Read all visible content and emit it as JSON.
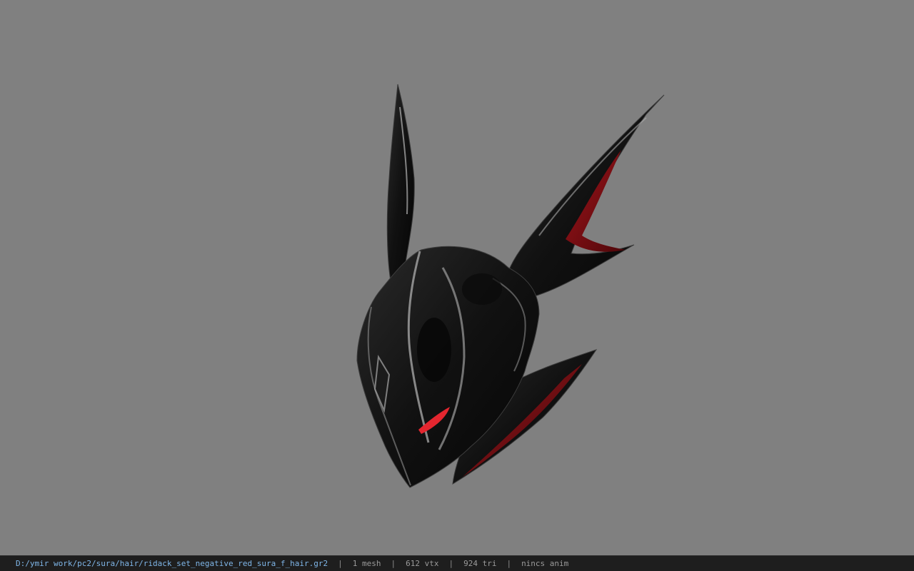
{
  "viewer": {
    "background": "#808080",
    "model": "helmet-model",
    "colors": {
      "shell": "#141414",
      "highlight": "#9a9a9a",
      "inner": "#7a0d12",
      "eye": "#e3262f"
    }
  },
  "status_bar": {
    "file_path": "D:/ymir work/pc2/sura/hair/ridack_set_negative_red_sura_f_hair.gr2",
    "separator": "|",
    "mesh_count": "1 mesh",
    "vertex_count": "612 vtx",
    "triangle_count": "924 tri",
    "anim_status": "nincs anim"
  }
}
